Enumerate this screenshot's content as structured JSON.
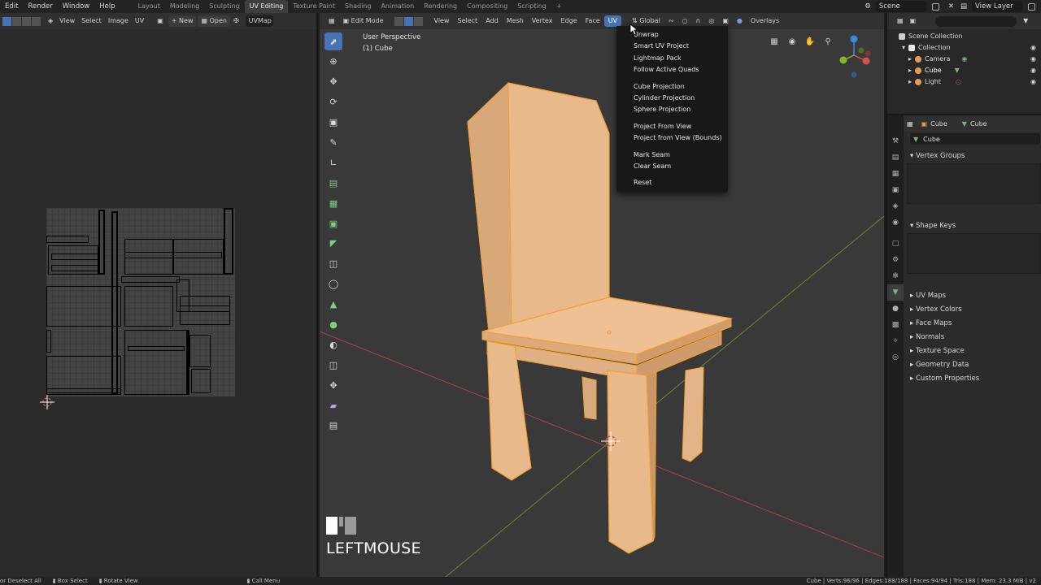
{
  "topbar": {
    "menus": [
      "Edit",
      "Render",
      "Window",
      "Help"
    ],
    "workspaces": [
      "Layout",
      "Modeling",
      "Sculpting",
      "UV Editing",
      "Texture Paint",
      "Shading",
      "Animation",
      "Rendering",
      "Compositing",
      "Scripting"
    ],
    "active_workspace": "UV Editing",
    "add_tab": "+",
    "scene": "Scene",
    "view_layer": "View Layer"
  },
  "uv_editor": {
    "header": {
      "view": "View",
      "select": "Select",
      "image": "Image",
      "uv": "UV",
      "new": "New",
      "open": "Open",
      "uvmap": "UVMap"
    }
  },
  "viewport": {
    "header": {
      "mode": "Edit Mode",
      "view": "View",
      "select": "Select",
      "add": "Add",
      "mesh": "Mesh",
      "vertex": "Vertex",
      "edge": "Edge",
      "face": "Face",
      "uv": "UV",
      "orientation": "Global",
      "overlays": "Overlays"
    },
    "info_line1": "User Perspective",
    "info_line2": "(1) Cube",
    "key_display": "LEFTMOUSE"
  },
  "uv_menu": {
    "items": [
      [
        "Unwrap",
        "Smart UV Project",
        "Lightmap Pack",
        "Follow Active Quads"
      ],
      [
        "Cube Projection",
        "Cylinder Projection",
        "Sphere Projection"
      ],
      [
        "Project From View",
        "Project from View (Bounds)"
      ],
      [
        "Mark Seam",
        "Clear Seam"
      ],
      [
        "Reset"
      ]
    ]
  },
  "outliner": {
    "rows": [
      {
        "label": "Scene Collection",
        "icon": "collection-icon",
        "color": "#cccccc"
      },
      {
        "label": "Collection",
        "icon": "collection-icon",
        "color": "#e8e8e8"
      },
      {
        "label": "Camera",
        "icon": "camera-icon",
        "color": "#e89b52"
      },
      {
        "label": "Cube",
        "icon": "mesh-icon",
        "color": "#e89b52"
      },
      {
        "label": "Light",
        "icon": "light-icon",
        "color": "#e89b52"
      }
    ]
  },
  "properties": {
    "object_name": "Cube",
    "mesh_name": "Cube",
    "mesh_field": "Cube",
    "panels": {
      "vertex_groups": "Vertex Groups",
      "shape_keys": "Shape Keys",
      "uv_maps": "UV Maps",
      "vertex_colors": "Vertex Colors",
      "face_maps": "Face Maps",
      "normals": "Normals",
      "texture_space": "Texture Space",
      "geometry_data": "Geometry Data",
      "custom_properties": "Custom Properties"
    }
  },
  "statusbar": {
    "deselect": "or Deselect All",
    "box_select": "Box Select",
    "rotate_view": "Rotate View",
    "call_menu": "Call Menu",
    "stats": "Cube | Verts:96/96 | Edges:188/188 | Faces:94/94 | Tris:188 | Mem: 23.3 MiB | v2"
  },
  "colors": {
    "accent": "#4772b3",
    "mesh_fill": "#e8b98a",
    "mesh_edge": "#f0a030",
    "grid_x_axis": "#c24a4a",
    "grid_y_axis": "#7d9c2a"
  }
}
